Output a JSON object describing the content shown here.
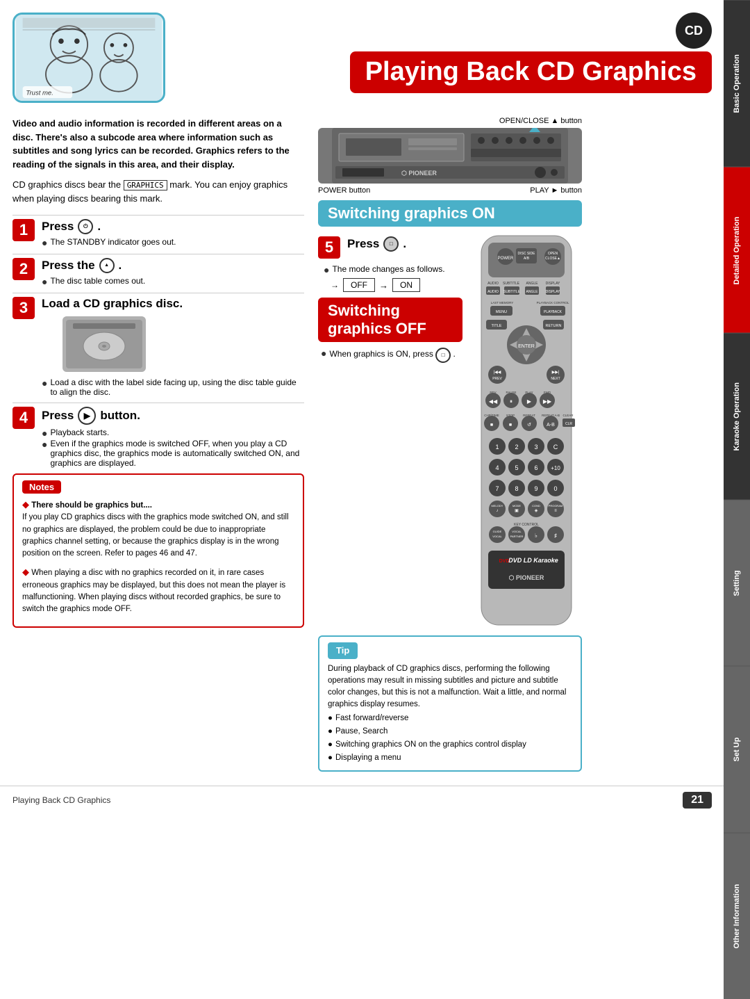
{
  "page": {
    "title": "Playing Back CD Graphics",
    "page_number": "21",
    "cd_icon_label": "CD"
  },
  "side_tabs": [
    {
      "label": "Basic Operation",
      "active": false
    },
    {
      "label": "Detailed Operation",
      "active": true
    },
    {
      "label": "Karaoke Operation",
      "active": false
    },
    {
      "label": "Setting",
      "active": false
    },
    {
      "label": "Set Up",
      "active": false
    },
    {
      "label": "Other Information",
      "active": false
    }
  ],
  "header": {
    "trust_me_text": "Trust me.",
    "intro_bold": "Video and audio information is recorded in different areas on a disc. There's also a subcode area where information such as subtitles and song lyrics can be recorded. Graphics refers to the reading of the signals in this area, and their display.",
    "intro_note": "CD graphics discs bear the  GRAPHICS  mark. You can enjoy graphics when playing discs bearing this mark."
  },
  "steps": [
    {
      "num": "1",
      "title_text": "Press",
      "button_label": "POWER",
      "note": "The STANDBY indicator goes out."
    },
    {
      "num": "2",
      "title_text": "Press the",
      "button_label": "OPEN/CLOSE",
      "note": "The disc table comes out."
    },
    {
      "num": "3",
      "title_text": "Load a CD graphics disc.",
      "note1": "Load a disc with the label side facing up, using the disc table guide to align the disc."
    },
    {
      "num": "4",
      "title_text": "Press",
      "button_label": "PLAY",
      "button_suffix": "button.",
      "note1": "Playback starts.",
      "note2": "Even if the graphics mode is switched OFF, when you play a CD graphics disc, the graphics mode is automatically switched ON, and graphics are displayed."
    }
  ],
  "device": {
    "open_close_label": "OPEN/CLOSE ▲ button",
    "power_label": "POWER button",
    "play_label": "PLAY ► button"
  },
  "switching_on": {
    "header": "Switching graphics ON",
    "step_num": "5",
    "step_text": "Press",
    "note": "The mode changes as follows.",
    "flow_off": "OFF",
    "flow_arrow": "→",
    "flow_on": "ON"
  },
  "switching_off": {
    "header": "Switching graphics OFF",
    "note": "When graphics is ON, press"
  },
  "notes": {
    "title": "Notes",
    "items": [
      {
        "title": "There should be graphics but....",
        "body": "If you play CD graphics discs with the graphics mode switched ON, and still no graphics are displayed, the problem could be due to inappropriate graphics channel setting, or because the graphics display is in the wrong position on the screen. Refer to pages 46 and 47."
      },
      {
        "title": "",
        "body": "When playing a disc with no graphics recorded on it, in rare cases erroneous graphics may be displayed, but this does not mean the player is malfunctioning. When playing discs without recorded graphics, be sure to switch the graphics mode OFF."
      }
    ]
  },
  "tip": {
    "title": "Tip",
    "intro": "During playback of CD graphics discs, performing the following operations may result in missing subtitles and picture and subtitle color changes, but this is not a malfunction. Wait a little, and normal graphics display resumes.",
    "bullets": [
      "Fast forward/reverse",
      "Pause, Search",
      "Switching graphics ON on the graphics control display",
      "Displaying a menu"
    ]
  },
  "remote_buttons": {
    "power": "POWER",
    "disc_side": "DISC SIDE A/B",
    "open_close": "OPEN CLOSE",
    "audio": "AUDIO",
    "subtitle": "SUBTITLE",
    "angle": "ANGLE",
    "display": "DISPLAY",
    "last_memory": "LAST MEMORY",
    "menu": "MENU",
    "playback_control": "PLAYBACK CONTROL",
    "title": "TITLE",
    "return": "RETURN",
    "enter": "ENTER",
    "prev": "PREV",
    "next": "NEXT",
    "rev": "REV",
    "pause": "PAUSE",
    "play": "PLAY",
    "fwd": "FWD",
    "chp_time": "CHP/TIME",
    "stop": "STOP",
    "repeat": "REPEAT",
    "repeat_ab": "REPEAT A-B",
    "clear": "CLEAR",
    "nums": [
      "1",
      "2",
      "3",
      "C",
      "4",
      "5",
      "6",
      "+10",
      "7",
      "8",
      "9",
      "0"
    ],
    "melody": "MELODY",
    "mode": "MODE",
    "condition": "CONDITION",
    "program": "PROGRAM",
    "guide_vocal": "GUIDE VOCAL",
    "vocal_partner": "VOCAL PARTNER",
    "key_control": "KEY CONTROL",
    "dvd_label": "DVD LD Karaoke",
    "pioneer_label": "PIONEER"
  }
}
